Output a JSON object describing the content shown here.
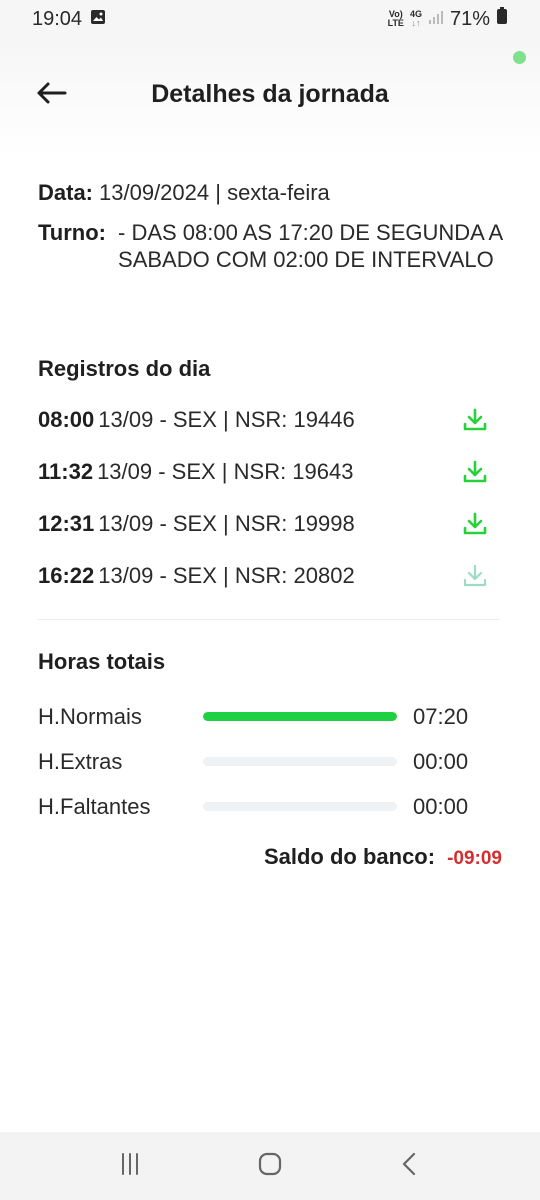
{
  "status_bar": {
    "time": "19:04",
    "network_top": "Vo)",
    "network_bottom": "LTE",
    "data_top": "4G",
    "data_bottom": "↓↑",
    "battery": "71%",
    "icons": [
      "image-icon",
      "signal-icon",
      "battery-icon"
    ]
  },
  "header": {
    "title": "Detalhes da jornada",
    "back_icon": "arrow-left-icon"
  },
  "info": {
    "date_label": "Data:",
    "date_value": "13/09/2024 | sexta-feira",
    "turno_label": "Turno:",
    "turno_value": "- DAS 08:00 AS 17:20 DE SEGUNDA A SABADO COM 02:00 DE INTERVALO"
  },
  "records": {
    "title": "Registros do dia",
    "items": [
      {
        "time": "08:00",
        "detail": "13/09 - SEX | NSR: 19446",
        "icon": "download-icon",
        "icon_color": "#27d13a"
      },
      {
        "time": "11:32",
        "detail": "13/09 - SEX | NSR: 19643",
        "icon": "download-icon",
        "icon_color": "#27d13a"
      },
      {
        "time": "12:31",
        "detail": "13/09 - SEX | NSR: 19998",
        "icon": "download-icon",
        "icon_color": "#27d13a"
      },
      {
        "time": "16:22",
        "detail": "13/09 - SEX | NSR: 20802",
        "icon": "download-icon",
        "icon_color": "#9edcc7"
      }
    ]
  },
  "hours": {
    "title": "Horas totais",
    "items": [
      {
        "label": "H.Normais",
        "value": "07:20",
        "fill_fraction": 1.0
      },
      {
        "label": "H.Extras",
        "value": "00:00",
        "fill_fraction": 0
      },
      {
        "label": "H.Faltantes",
        "value": "00:00",
        "fill_fraction": 0
      }
    ],
    "saldo_label": "Saldo do banco:",
    "saldo_value": "-09:09"
  },
  "colors": {
    "accent_green": "#1ed142",
    "negative_red": "#d32f2f",
    "online_dot": "#7fe08d"
  },
  "nav": {
    "icons": [
      "recent-apps-icon",
      "home-icon",
      "back-icon"
    ]
  }
}
